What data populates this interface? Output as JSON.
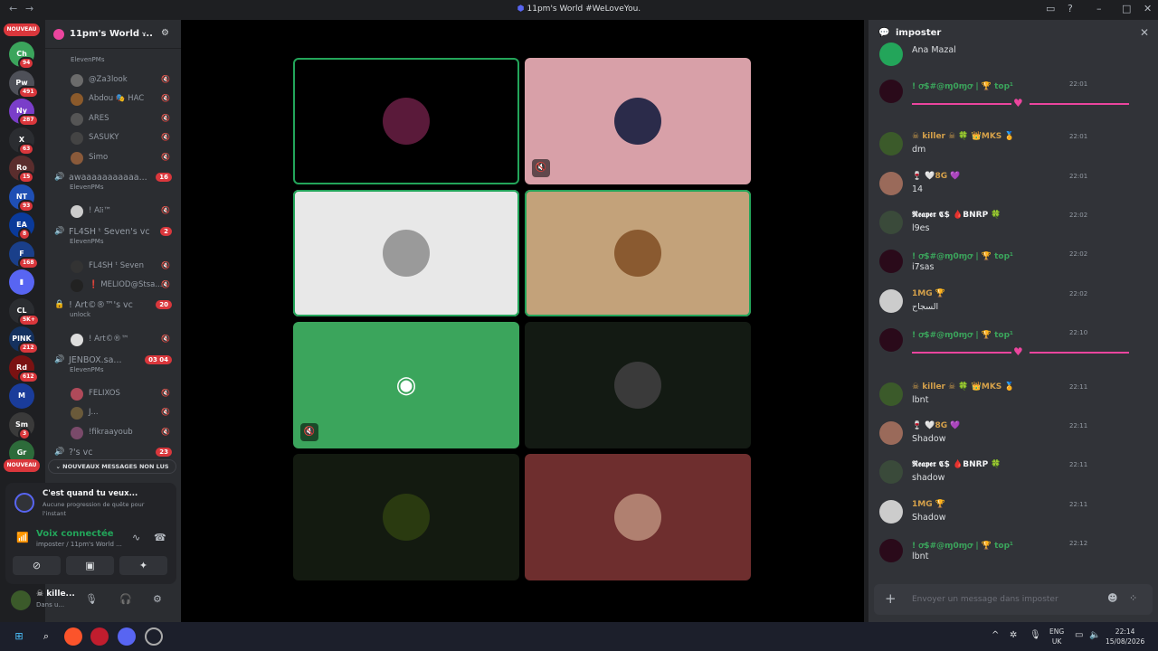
{
  "window": {
    "title": "11pm's World #WeLoveYou.",
    "back": "←",
    "forward": "→"
  },
  "guilds": {
    "new_top": "NOUVEAU",
    "new_bottom": "NOUVEAU",
    "items": [
      {
        "badge": "94",
        "color": "#3ba55c",
        "label": "Ch"
      },
      {
        "badge": "491",
        "color": "#4e5058",
        "label": "Pw"
      },
      {
        "badge": "287",
        "color": "#7a3ec9",
        "label": "Ny"
      },
      {
        "badge": "63",
        "color": "#2b2d31",
        "label": "X"
      },
      {
        "badge": "15",
        "color": "#5a2d2d",
        "label": "Ro"
      },
      {
        "badge": "93",
        "color": "#1f4fb4",
        "label": "NT"
      },
      {
        "badge": "8",
        "color": "#0a3a9a",
        "label": "EA"
      },
      {
        "badge": "168",
        "color": "#1a3f8a",
        "label": "F"
      },
      {
        "badge": "",
        "color": "#5865f2",
        "label": "▮"
      },
      {
        "badge": "5K+",
        "color": "#2b2d31",
        "label": "CL"
      },
      {
        "badge": "212",
        "color": "#14315f",
        "label": "PlNK"
      },
      {
        "badge": "612",
        "color": "#7a1212",
        "label": "Rd"
      },
      {
        "badge": "",
        "color": "#1a3c9a",
        "label": "M"
      },
      {
        "badge": "3",
        "color": "#3a3a3a",
        "label": "Sm"
      },
      {
        "badge": "",
        "color": "#2d6b3a",
        "label": "Gr"
      }
    ]
  },
  "server": {
    "name": "11pm's World ...",
    "chevron": "⌄",
    "invite_icon": "⚙"
  },
  "channels": [
    {
      "name": "ElevenPMs",
      "sub": "",
      "count": "",
      "users": [
        {
          "name": "@Za3look",
          "color": "#6b6b6b"
        },
        {
          "name": "Abdou 🎭 HAC",
          "color": "#8b5a2b"
        },
        {
          "name": "ARES",
          "color": "#555"
        },
        {
          "name": "SASUKY",
          "color": "#444"
        },
        {
          "name": "Simo",
          "color": "#8a5a3a"
        }
      ]
    },
    {
      "name": "awaaaaaaaaaaa...",
      "sub": "ElevenPMs",
      "count": "16",
      "users": [
        {
          "name": "! A𝔩𝔦™",
          "color": "#ccc"
        }
      ]
    },
    {
      "name": "FL4SH ᵗ Seven's vc",
      "sub": "ElevenPMs",
      "count": "2",
      "users": [
        {
          "name": "FL4SH ᵗ Seven",
          "color": "#333"
        },
        {
          "name": "❗ MELIOD@Stsa...",
          "color": "#222"
        }
      ]
    },
    {
      "name": "! Art©®™'s vc",
      "sub": "unlock",
      "count": "20",
      "users": [
        {
          "name": "! Art©®™",
          "color": "#ddd"
        }
      ]
    },
    {
      "name": "JENBOX.sa...",
      "sub": "ElevenPMs",
      "count": "03 04",
      "users": [
        {
          "name": "FELIXOS",
          "color": "#b04a5a"
        },
        {
          "name": "J...",
          "color": "#6a5a3a"
        },
        {
          "name": "!fikraayoub",
          "color": "#7a4a6a"
        }
      ]
    },
    {
      "name": "?'s vc",
      "sub": "",
      "count": "23",
      "users": []
    }
  ],
  "new_messages_bar": "⌄ NOUVEAUX MESSAGES NON LUS",
  "quest": {
    "title": "C'est quand tu veux...",
    "subtitle": "Aucune progression de quête pour l'instant"
  },
  "voice": {
    "status": "Voix connectée",
    "detail": "imposter / 11pm's World ...",
    "btn_camera": "⊘",
    "btn_share": "▣",
    "btn_activity": "✦"
  },
  "user": {
    "name": "☠ kille...",
    "status": "Dans u..."
  },
  "stage": {
    "tiles": [
      {
        "bg": "#000000",
        "avatar": "#5a1a3a",
        "speaking": true,
        "muted": false
      },
      {
        "bg": "#d8a0a8",
        "avatar": "#2b2b4a",
        "speaking": false,
        "muted": true
      },
      {
        "bg": "#e8e8e8",
        "avatar": "#9a9a9a",
        "speaking": true,
        "muted": false
      },
      {
        "bg": "#c3a27a",
        "avatar": "#8a5a30",
        "speaking": true,
        "muted": false
      },
      {
        "bg": "#3ba55c",
        "avatar": "",
        "speaking": false,
        "muted": true
      },
      {
        "bg": "#131a13",
        "avatar": "#3a3a3a",
        "speaking": false,
        "muted": false
      },
      {
        "bg": "#131a10",
        "avatar": "#2a3a10",
        "speaking": false,
        "muted": false
      },
      {
        "bg": "#6e2e2e",
        "avatar": "#b08070",
        "speaking": false,
        "muted": false
      }
    ]
  },
  "chat": {
    "channel": "imposter",
    "placeholder": "Envoyer un message dans imposter",
    "messages": [
      {
        "author": "",
        "time": "",
        "text": "Ana Mazal",
        "author_color": "#f2f3f5",
        "av": "#23a55a"
      },
      {
        "author": "! ꝍ$#@ɱ0ɱꝍ | 🏆 top¹",
        "time": "22:01",
        "text": "",
        "author_color": "#3ba55c",
        "av": "#2a0a1a",
        "divider": true
      },
      {
        "author": "☠ killer ☠ 🍀 👑MKS 🏅",
        "time": "22:01",
        "text": "dm",
        "author_color": "#d4a04a",
        "av": "#3b5a2a"
      },
      {
        "author": "🍷 🤍8G 💜",
        "time": "22:01",
        "text": "14",
        "author_color": "#d4a04a",
        "av": "#9a6a5a"
      },
      {
        "author": "𝕽𝖊𝖆𝖕𝖊𝖗 𝕮$ 🩸BNRP 🍀",
        "time": "22:02",
        "text": "l9es",
        "author_color": "#f2f3f5",
        "av": "#3a4a3a"
      },
      {
        "author": "! ꝍ$#@ɱ0ɱꝍ | 🏆 top¹",
        "time": "22:02",
        "text": "i7sas",
        "author_color": "#3ba55c",
        "av": "#2a0a1a"
      },
      {
        "author": "1MG 🏆",
        "time": "22:02",
        "text": "السجاح",
        "author_color": "#d4a04a",
        "av": "#cccccc"
      },
      {
        "author": "! ꝍ$#@ɱ0ɱꝍ | 🏆 top¹",
        "time": "22:10",
        "text": "",
        "author_color": "#3ba55c",
        "av": "#2a0a1a",
        "divider": true
      },
      {
        "author": "☠ killer ☠ 🍀 👑MKS 🏅",
        "time": "22:11",
        "text": "lbnt",
        "author_color": "#d4a04a",
        "av": "#3b5a2a"
      },
      {
        "author": "🍷 🤍8G 💜",
        "time": "22:11",
        "text": "Shadow",
        "author_color": "#d4a04a",
        "av": "#9a6a5a"
      },
      {
        "author": "𝕽𝖊𝖆𝖕𝖊𝖗 𝕮$ 🩸BNRP 🍀",
        "time": "22:11",
        "text": "shadow",
        "author_color": "#f2f3f5",
        "av": "#3a4a3a"
      },
      {
        "author": "1MG 🏆",
        "time": "22:11",
        "text": "Shadow",
        "author_color": "#d4a04a",
        "av": "#cccccc"
      },
      {
        "author": "! ꝍ$#@ɱ0ɱꝍ | 🏆 top¹",
        "time": "22:12",
        "text": "lbnt",
        "author_color": "#3ba55c",
        "av": "#2a0a1a"
      }
    ]
  },
  "taskbar": {
    "lang1": "ENG",
    "lang2": "UK",
    "time": "22:14",
    "date": "15/08/2026",
    "chevron": "^"
  }
}
